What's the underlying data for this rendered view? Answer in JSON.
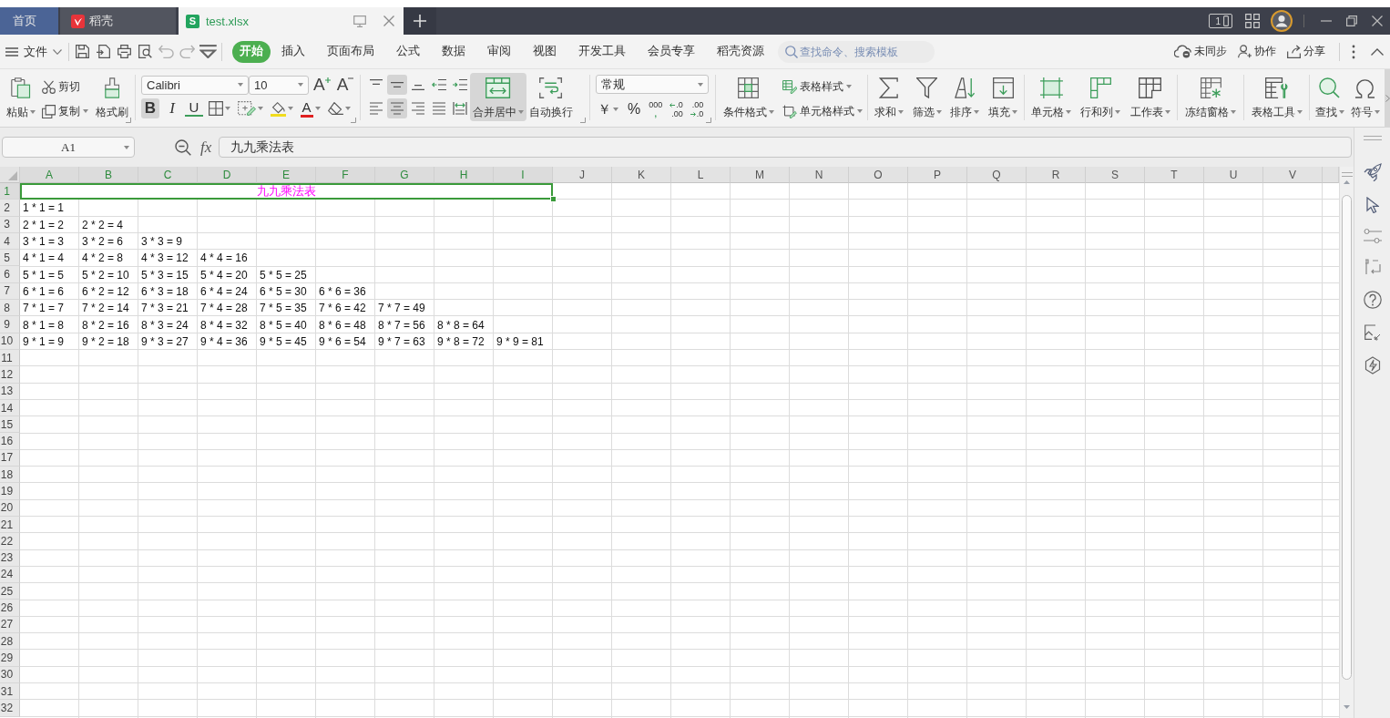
{
  "title_bar": {
    "display_badge": "1"
  },
  "tabs": [
    {
      "label": "首页",
      "kind": "home",
      "selected": false
    },
    {
      "label": "稻壳",
      "kind": "docer",
      "selected": false
    },
    {
      "label": "test.xlsx",
      "kind": "sheet",
      "badge": "S",
      "selected": true
    }
  ],
  "menu": {
    "file": "文件",
    "items": [
      {
        "label": "开始",
        "selected": true
      },
      {
        "label": "插入",
        "selected": false
      },
      {
        "label": "页面布局",
        "selected": false
      },
      {
        "label": "公式",
        "selected": false
      },
      {
        "label": "数据",
        "selected": false
      },
      {
        "label": "审阅",
        "selected": false
      },
      {
        "label": "视图",
        "selected": false
      },
      {
        "label": "开发工具",
        "selected": false
      },
      {
        "label": "会员专享",
        "selected": false
      },
      {
        "label": "稻壳资源",
        "selected": false
      }
    ],
    "search": {
      "placeholder": "查找命令、搜索模板"
    },
    "actions": [
      {
        "label": "未同步"
      },
      {
        "label": "协作"
      },
      {
        "label": "分享"
      }
    ]
  },
  "ribbon": [
    {
      "items": [
        {
          "kind": "large",
          "label": "粘贴",
          "caret": true,
          "on": false
        },
        {
          "kind": "stack",
          "rows": [
            {
              "label": "剪切",
              "caret": false
            },
            {
              "label": "复制",
              "caret": true
            }
          ]
        },
        {
          "kind": "large",
          "label": "格式刷",
          "caret": false,
          "on": false
        }
      ]
    },
    {
      "items": [
        {
          "kind": "font",
          "font_name": "Calibri",
          "font_size": "10",
          "grow": "A",
          "shrink": "A",
          "styles": [
            {
              "kind": "bold",
              "text": "B",
              "on": true
            },
            {
              "kind": "italic",
              "text": "I",
              "on": false
            },
            {
              "kind": "underline",
              "text": "U",
              "on": false
            }
          ],
          "color_letter": "A"
        }
      ]
    },
    {
      "items": [
        {
          "kind": "align",
          "vertical": [
            {
              "on": false
            },
            {
              "on": true
            },
            {
              "on": false
            }
          ],
          "horizontal": [
            {
              "on": false
            },
            {
              "on": true
            },
            {
              "on": false
            },
            {
              "on": false
            }
          ]
        },
        {
          "kind": "large",
          "label": "合并居中",
          "caret": true,
          "on": true
        },
        {
          "kind": "large",
          "label": "自动换行",
          "caret": false,
          "on": false
        }
      ]
    },
    {
      "items": [
        {
          "kind": "number",
          "format": "常规",
          "currency": "￥",
          "percent": "%",
          "thousands": [
            "000",
            ","
          ],
          "inc_decimal": [
            ".0",
            ".00"
          ],
          "dec_decimal": [
            ".00",
            ".0"
          ]
        }
      ]
    },
    {
      "items": [
        {
          "kind": "large",
          "label": "条件格式",
          "caret": true,
          "on": false
        },
        {
          "kind": "stack",
          "rows": [
            {
              "label": "表格样式",
              "caret": true
            },
            {
              "label": "单元格样式",
              "caret": true
            }
          ]
        }
      ]
    },
    {
      "items": [
        {
          "kind": "large",
          "label": "求和",
          "caret": true,
          "on": false
        },
        {
          "kind": "large",
          "label": "筛选",
          "caret": true,
          "on": false
        },
        {
          "kind": "large",
          "label": "排序",
          "caret": true,
          "on": false
        },
        {
          "kind": "large",
          "label": "填充",
          "caret": true,
          "on": false
        }
      ]
    },
    {
      "items": [
        {
          "kind": "large",
          "label": "单元格",
          "caret": true,
          "on": false
        },
        {
          "kind": "large",
          "label": "行和列",
          "caret": true,
          "on": false
        },
        {
          "kind": "large",
          "label": "工作表",
          "caret": true,
          "on": false
        }
      ]
    },
    {
      "items": [
        {
          "kind": "large",
          "label": "冻结窗格",
          "caret": true,
          "on": false
        }
      ]
    },
    {
      "items": [
        {
          "kind": "large",
          "label": "表格工具",
          "caret": true,
          "on": false
        }
      ]
    },
    {
      "items": [
        {
          "kind": "large",
          "label": "查找",
          "caret": true,
          "on": false
        },
        {
          "kind": "large",
          "label": "符号",
          "caret": true,
          "on": false
        }
      ]
    }
  ],
  "formula_bar": {
    "name_box": "A1",
    "function_label": "fx",
    "formula": "九九乘法表"
  },
  "grid": {
    "columns": [
      {
        "label": "A",
        "selected": true
      },
      {
        "label": "B",
        "selected": true
      },
      {
        "label": "C",
        "selected": true
      },
      {
        "label": "D",
        "selected": true
      },
      {
        "label": "E",
        "selected": true
      },
      {
        "label": "F",
        "selected": true
      },
      {
        "label": "G",
        "selected": true
      },
      {
        "label": "H",
        "selected": true
      },
      {
        "label": "I",
        "selected": true
      },
      {
        "label": "J",
        "selected": false
      },
      {
        "label": "K",
        "selected": false
      },
      {
        "label": "L",
        "selected": false
      },
      {
        "label": "M",
        "selected": false
      },
      {
        "label": "N",
        "selected": false
      },
      {
        "label": "O",
        "selected": false
      },
      {
        "label": "P",
        "selected": false
      },
      {
        "label": "Q",
        "selected": false
      },
      {
        "label": "R",
        "selected": false
      },
      {
        "label": "S",
        "selected": false
      },
      {
        "label": "T",
        "selected": false
      },
      {
        "label": "U",
        "selected": false
      },
      {
        "label": "V",
        "selected": false
      }
    ],
    "rows": [
      {
        "header": "1",
        "selected": true,
        "kind": "title",
        "title": {
          "text": "九九乘法表",
          "selected": true
        }
      },
      {
        "header": "2",
        "selected": false,
        "kind": "values",
        "cells": [
          "1 * 1 = 1"
        ]
      },
      {
        "header": "3",
        "selected": false,
        "kind": "values",
        "cells": [
          "2 * 1 = 2",
          "2 * 2 = 4"
        ]
      },
      {
        "header": "4",
        "selected": false,
        "kind": "values",
        "cells": [
          "3 * 1 = 3",
          "3 * 2 = 6",
          "3 * 3 = 9"
        ]
      },
      {
        "header": "5",
        "selected": false,
        "kind": "values",
        "cells": [
          "4 * 1 = 4",
          "4 * 2 = 8",
          "4 * 3 = 12",
          "4 * 4 = 16"
        ]
      },
      {
        "header": "6",
        "selected": false,
        "kind": "values",
        "cells": [
          "5 * 1 = 5",
          "5 * 2 = 10",
          "5 * 3 = 15",
          "5 * 4 = 20",
          "5 * 5 = 25"
        ]
      },
      {
        "header": "7",
        "selected": false,
        "kind": "values",
        "cells": [
          "6 * 1 = 6",
          "6 * 2 = 12",
          "6 * 3 = 18",
          "6 * 4 = 24",
          "6 * 5 = 30",
          "6 * 6 = 36"
        ]
      },
      {
        "header": "8",
        "selected": false,
        "kind": "values",
        "cells": [
          "7 * 1 = 7",
          "7 * 2 = 14",
          "7 * 3 = 21",
          "7 * 4 = 28",
          "7 * 5 = 35",
          "7 * 6 = 42",
          "7 * 7 = 49"
        ]
      },
      {
        "header": "9",
        "selected": false,
        "kind": "values",
        "cells": [
          "8 * 1 = 8",
          "8 * 2 = 16",
          "8 * 3 = 24",
          "8 * 4 = 32",
          "8 * 5 = 40",
          "8 * 6 = 48",
          "8 * 7 = 56",
          "8 * 8 = 64"
        ]
      },
      {
        "header": "10",
        "selected": false,
        "kind": "values",
        "cells": [
          "9 * 1 = 9",
          "9 * 2 = 18",
          "9 * 3 = 27",
          "9 * 4 = 36",
          "9 * 5 = 45",
          "9 * 6 = 54",
          "9 * 7 = 63",
          "9 * 8 = 72",
          "9 * 9 = 81"
        ]
      },
      {
        "header": "11",
        "selected": false,
        "kind": "empty"
      },
      {
        "header": "12",
        "selected": false,
        "kind": "empty"
      },
      {
        "header": "13",
        "selected": false,
        "kind": "empty"
      },
      {
        "header": "14",
        "selected": false,
        "kind": "empty"
      },
      {
        "header": "15",
        "selected": false,
        "kind": "empty"
      },
      {
        "header": "16",
        "selected": false,
        "kind": "empty"
      },
      {
        "header": "17",
        "selected": false,
        "kind": "empty"
      },
      {
        "header": "18",
        "selected": false,
        "kind": "empty"
      },
      {
        "header": "19",
        "selected": false,
        "kind": "empty"
      },
      {
        "header": "20",
        "selected": false,
        "kind": "empty"
      },
      {
        "header": "21",
        "selected": false,
        "kind": "empty"
      },
      {
        "header": "22",
        "selected": false,
        "kind": "empty"
      },
      {
        "header": "23",
        "selected": false,
        "kind": "empty"
      },
      {
        "header": "24",
        "selected": false,
        "kind": "empty"
      },
      {
        "header": "25",
        "selected": false,
        "kind": "empty"
      },
      {
        "header": "26",
        "selected": false,
        "kind": "empty"
      },
      {
        "header": "27",
        "selected": false,
        "kind": "empty"
      },
      {
        "header": "28",
        "selected": false,
        "kind": "empty"
      },
      {
        "header": "29",
        "selected": false,
        "kind": "empty"
      },
      {
        "header": "30",
        "selected": false,
        "kind": "empty"
      },
      {
        "header": "31",
        "selected": false,
        "kind": "empty"
      },
      {
        "header": "32",
        "selected": false,
        "kind": "empty"
      }
    ]
  }
}
